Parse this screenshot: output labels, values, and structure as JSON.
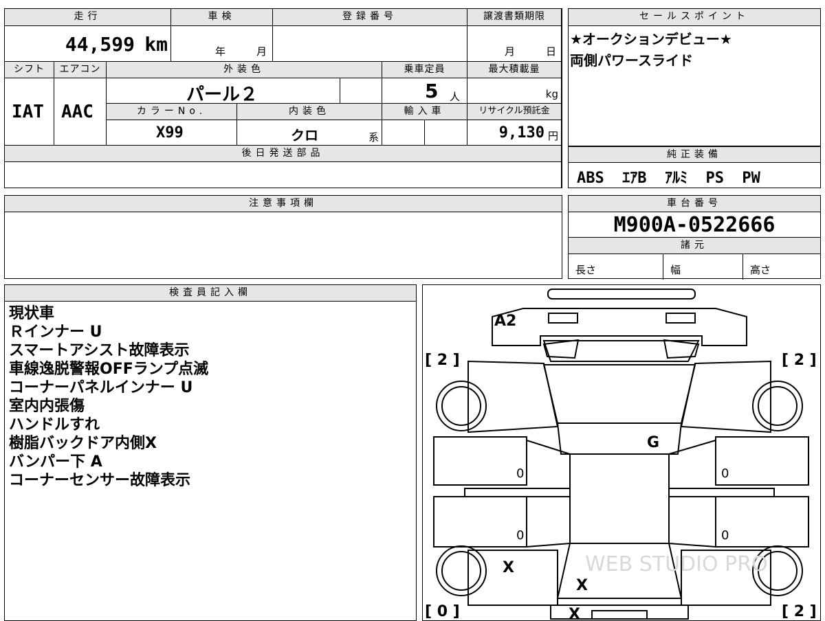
{
  "vehicle": {
    "mileage_label": "走行",
    "mileage_value": "44,599",
    "mileage_unit": "km",
    "shaken_label": "車検",
    "shaken_year": "年",
    "shaken_month": "月",
    "reg_no_label": "登録番号",
    "transfer_label": "譲渡書類期限",
    "transfer_month": "月",
    "transfer_day": "日",
    "shift_label": "シフト",
    "shift_value": "IAT",
    "ac_label": "エアコン",
    "ac_value": "AAC",
    "exterior_label": "外装色",
    "exterior_value": "パール２",
    "capacity_label": "乗車定員",
    "capacity_value": "5",
    "capacity_unit": "人",
    "max_load_label": "最大積載量",
    "max_load_unit": "kg",
    "color_no_label": "カラーNo.",
    "color_no_value": "X99",
    "interior_label": "内装色",
    "interior_value": "クロ",
    "interior_suffix": "系",
    "import_label": "輸入車",
    "recycle_label": "リサイクル預託金",
    "recycle_value": "9,130",
    "recycle_unit": "円",
    "later_parts_label": "後日発送部品"
  },
  "sales_points": {
    "label": "セールスポイント",
    "lines": [
      "★オークションデビュー★",
      "両側パワースライド"
    ]
  },
  "equipment": {
    "label": "純正装備",
    "value": "ABS  ｴｱB  ｱﾙﾐ  PS  PW"
  },
  "caution": {
    "label": "注意事項欄"
  },
  "chassis": {
    "label": "車台番号",
    "value": "M900A-0522666",
    "spec_label": "諸元",
    "length_label": "長さ",
    "width_label": "幅",
    "height_label": "高さ"
  },
  "inspector": {
    "label": "検査員記入欄",
    "notes": [
      "現状車",
      "Ｒインナー U",
      "スマートアシスト故障表示",
      "車線逸脱警報OFFランプ点滅",
      "コーナーパネルインナー U",
      "室内内張傷",
      "ハンドルすれ",
      "樹脂バックドア内側X",
      "バンパー下 A",
      "コーナーセンサー故障表示"
    ]
  },
  "diagram": {
    "front_bumper_mark": "A2",
    "roof_mark": "G",
    "left_front_door_mark": "0",
    "right_front_door_mark": "0",
    "left_rear_door_mark": "0",
    "right_rear_door_mark": "0",
    "left_rear_wheel_mark": "X",
    "rear_center_mark": "X",
    "rear_bottom_mark": "X",
    "tire_front_left": "[ 2 ]",
    "tire_front_right": "[ 2 ]",
    "tire_rear_left": "[ 0 ]",
    "tire_rear_right": "[ 2 ]",
    "watermark": "WEB STUDIO PRO"
  }
}
